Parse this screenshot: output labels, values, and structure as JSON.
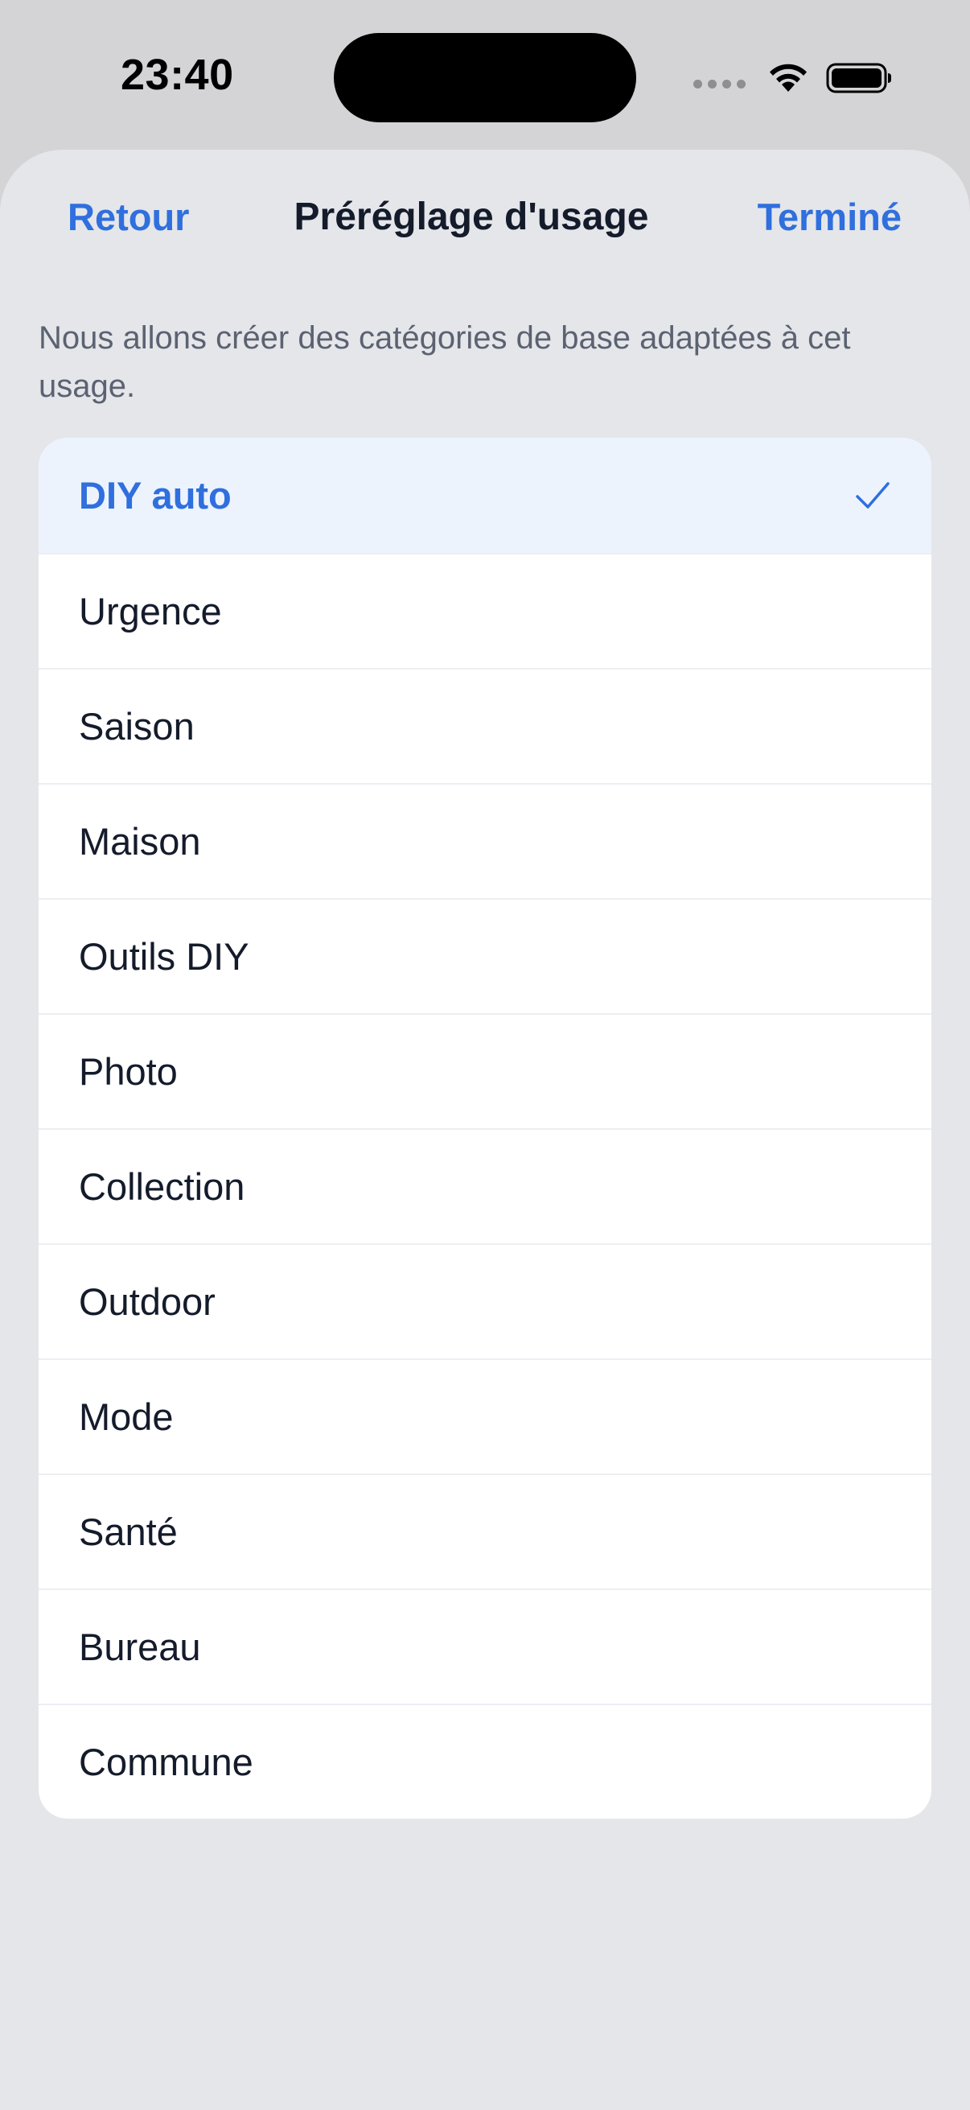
{
  "status_bar": {
    "time": "23:40",
    "icons": [
      "cellular-dots-icon",
      "wifi-icon",
      "battery-icon"
    ]
  },
  "nav": {
    "back_label": "Retour",
    "title": "Préréglage d'usage",
    "done_label": "Terminé"
  },
  "description": "Nous allons créer des catégories de base adaptées à cet usage.",
  "presets": {
    "selected": "DIY auto",
    "items": [
      {
        "label": "DIY auto"
      },
      {
        "label": "Urgence"
      },
      {
        "label": "Saison"
      },
      {
        "label": "Maison"
      },
      {
        "label": "Outils DIY"
      },
      {
        "label": "Photo"
      },
      {
        "label": "Collection"
      },
      {
        "label": "Outdoor"
      },
      {
        "label": "Mode"
      },
      {
        "label": "Santé"
      },
      {
        "label": "Bureau"
      },
      {
        "label": "Commune"
      }
    ]
  },
  "colors": {
    "accent": "#2f6fde",
    "sheet_background": "#e5e6ea",
    "selected_row_background": "#edf3fd",
    "text_primary": "#141b2b",
    "text_secondary": "#5b6271"
  }
}
